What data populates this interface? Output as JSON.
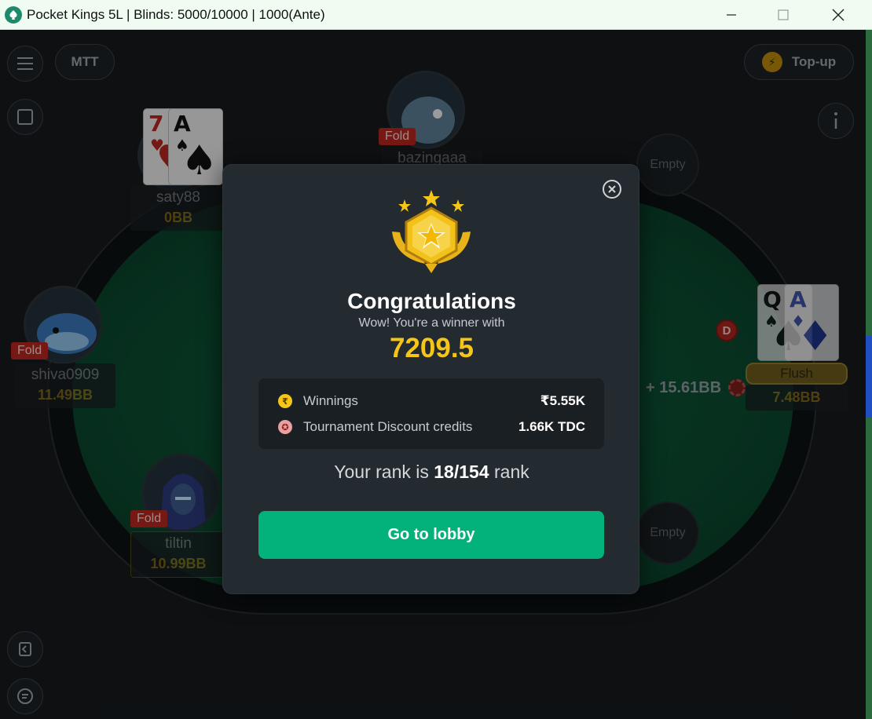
{
  "window": {
    "title": "Pocket Kings 5L | Blinds: 5000/10000 | 1000(Ante)"
  },
  "toolbar": {
    "mtt_label": "MTT",
    "topup_label": "Top-up"
  },
  "players": [
    {
      "name": "saty88",
      "stack": "0BB",
      "cards": [
        "7♥",
        "A♠"
      ]
    },
    {
      "name": "bazingaaa",
      "status": "Fold"
    },
    {
      "name": "shiva0909",
      "stack": "11.49BB",
      "status": "Fold"
    },
    {
      "name": "tiltin",
      "stack": "10.99BB",
      "status": "Fold"
    },
    {
      "stack": "7.48BB",
      "hand": "Flush",
      "cards": [
        "Q♠",
        "A♦"
      ],
      "bet": "+ 15.61BB",
      "dealer": "D"
    }
  ],
  "empty_seats": [
    "Empty",
    "Empty"
  ],
  "modal": {
    "title": "Congratulations",
    "subtitle": "Wow! You're a winner with",
    "amount": "7209.5",
    "rewards": [
      {
        "label": "Winnings",
        "value": "₹5.55K",
        "icon": "rupee-coin-icon",
        "icon_glyph": "₹"
      },
      {
        "label": "Tournament Discount credits",
        "value": "1.66K TDC",
        "icon": "tdc-badge-icon",
        "icon_glyph": "✪"
      }
    ],
    "rank_prefix": "Your rank is",
    "rank_value": "18/154",
    "rank_suffix": "rank",
    "button_label": "Go to lobby"
  },
  "colors": {
    "accent_green": "#03b27b",
    "gold": "#f5c518",
    "fold_red": "#b5261f"
  }
}
